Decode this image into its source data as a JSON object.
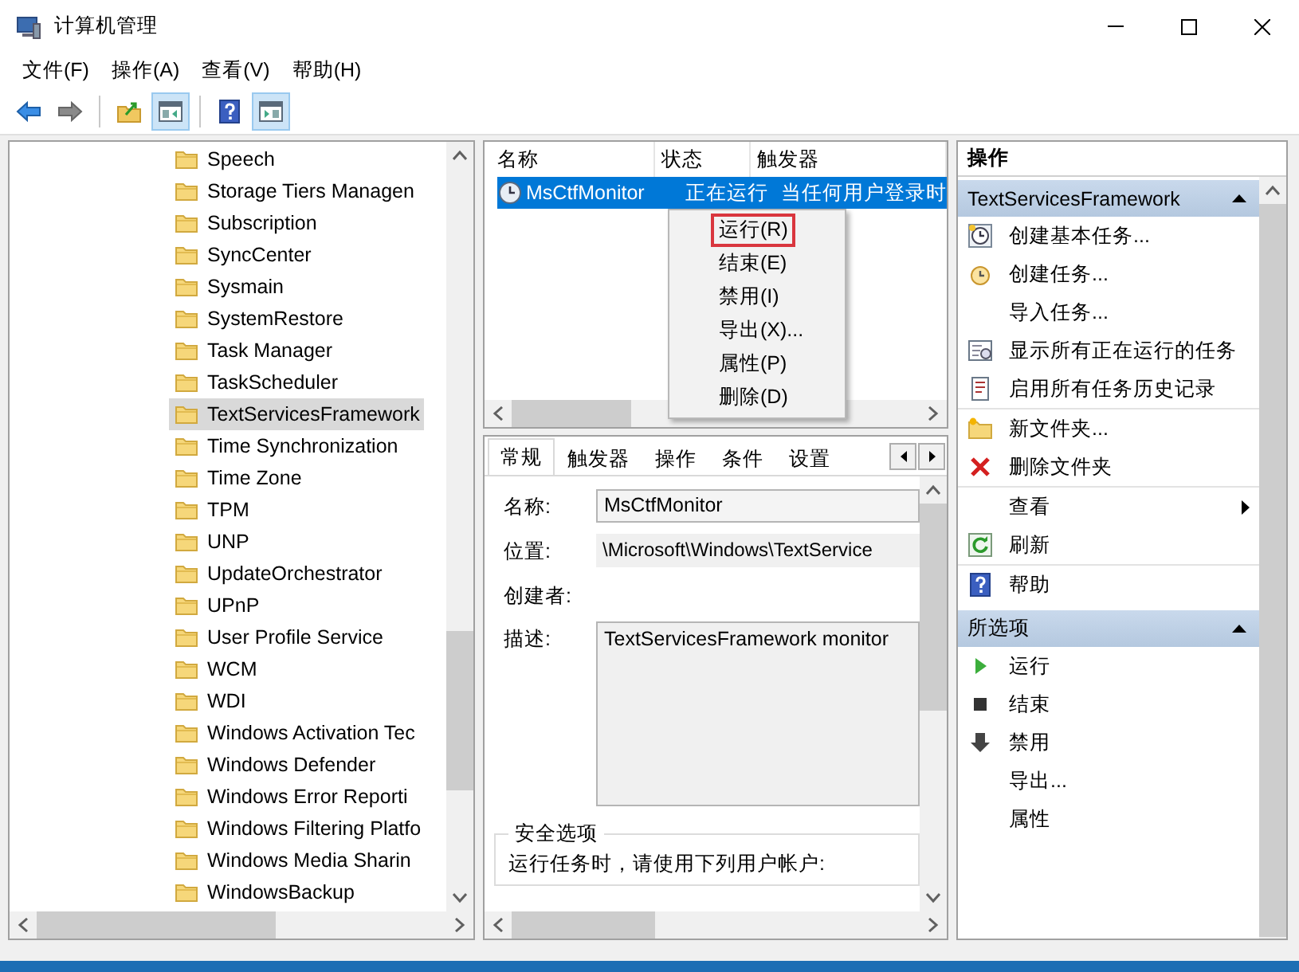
{
  "window": {
    "title": "计算机管理"
  },
  "menu_bar": [
    "文件(F)",
    "操作(A)",
    "查看(V)",
    "帮助(H)"
  ],
  "toolbar": {
    "groups": [
      [
        {
          "kind": "back",
          "pressed": false
        },
        {
          "kind": "forward",
          "pressed": false
        }
      ],
      [
        {
          "kind": "up",
          "pressed": false
        },
        {
          "kind": "console_tree",
          "pressed": true
        }
      ],
      [
        {
          "kind": "help",
          "pressed": false
        },
        {
          "kind": "action_pane",
          "pressed": true
        }
      ]
    ]
  },
  "tree": {
    "items": [
      {
        "label": "Speech",
        "selected": false
      },
      {
        "label": "Storage Tiers Managen",
        "selected": false
      },
      {
        "label": "Subscription",
        "selected": false
      },
      {
        "label": "SyncCenter",
        "selected": false
      },
      {
        "label": "Sysmain",
        "selected": false
      },
      {
        "label": "SystemRestore",
        "selected": false
      },
      {
        "label": "Task Manager",
        "selected": false
      },
      {
        "label": "TaskScheduler",
        "selected": false
      },
      {
        "label": "TextServicesFramework",
        "selected": true
      },
      {
        "label": "Time Synchronization",
        "selected": false
      },
      {
        "label": "Time Zone",
        "selected": false
      },
      {
        "label": "TPM",
        "selected": false
      },
      {
        "label": "UNP",
        "selected": false
      },
      {
        "label": "UpdateOrchestrator",
        "selected": false
      },
      {
        "label": "UPnP",
        "selected": false
      },
      {
        "label": "User Profile Service",
        "selected": false
      },
      {
        "label": "WCM",
        "selected": false
      },
      {
        "label": "WDI",
        "selected": false
      },
      {
        "label": "Windows Activation Tec",
        "selected": false
      },
      {
        "label": "Windows Defender",
        "selected": false
      },
      {
        "label": "Windows Error Reporti",
        "selected": false
      },
      {
        "label": "Windows Filtering Platfo",
        "selected": false
      },
      {
        "label": "Windows Media Sharin",
        "selected": false
      },
      {
        "label": "WindowsBackup",
        "selected": false
      }
    ]
  },
  "task_list": {
    "columns": [
      "名称",
      "状态",
      "触发器"
    ],
    "rows": [
      {
        "name": "MsCtfMonitor",
        "status": "正在运行",
        "trigger": "当任何用户登录时",
        "selected": true
      }
    ]
  },
  "context_menu": {
    "items": [
      {
        "label": "运行(R)",
        "outlined": true
      },
      {
        "label": "结束(E)",
        "outlined": false
      },
      {
        "label": "禁用(I)",
        "outlined": false
      },
      {
        "label": "导出(X)...",
        "outlined": false
      },
      {
        "label": "属性(P)",
        "outlined": false
      },
      {
        "label": "删除(D)",
        "outlined": false
      }
    ]
  },
  "details": {
    "tabs": [
      {
        "label": "常规",
        "selected": true
      },
      {
        "label": "触发器",
        "selected": false
      },
      {
        "label": "操作",
        "selected": false
      },
      {
        "label": "条件",
        "selected": false
      },
      {
        "label": "设置",
        "selected": false
      }
    ],
    "fields": [
      {
        "label": "名称:",
        "kind": "input",
        "value": "MsCtfMonitor"
      },
      {
        "label": "位置:",
        "kind": "text",
        "value": "\\Microsoft\\Windows\\TextService"
      },
      {
        "label": "创建者:",
        "kind": "text"
      },
      {
        "label": "描述:",
        "kind": "textarea",
        "value": "TextServicesFramework monitor"
      }
    ],
    "security": {
      "title": "安全选项",
      "text": "运行任务时，请使用下列用户帐户:"
    }
  },
  "actions": {
    "title": "操作",
    "sections": [
      {
        "title": "TextServicesFramework",
        "expanded": true,
        "groups": [
          [
            {
              "label": "创建基本任务...",
              "kind": "basic_task"
            },
            {
              "label": "创建任务...",
              "kind": "create_task"
            },
            {
              "label": "导入任务...",
              "kind": "none"
            },
            {
              "label": "显示所有正在运行的任务",
              "kind": "running"
            },
            {
              "label": "启用所有任务历史记录",
              "kind": "history"
            }
          ],
          [
            {
              "label": "新文件夹...",
              "kind": "new_folder"
            },
            {
              "label": "删除文件夹",
              "kind": "delete"
            }
          ],
          [
            {
              "label": "查看",
              "kind": "submenu"
            },
            {
              "label": "刷新",
              "kind": "refresh"
            }
          ],
          [
            {
              "label": "帮助",
              "kind": "help"
            }
          ]
        ]
      },
      {
        "title": "所选项",
        "expanded": true,
        "groups": [
          [
            {
              "label": "运行",
              "kind": "run"
            },
            {
              "label": "结束",
              "kind": "end"
            },
            {
              "label": "禁用",
              "kind": "disable"
            },
            {
              "label": "导出...",
              "kind": "none"
            },
            {
              "label": "属性",
              "kind": "none"
            }
          ]
        ]
      }
    ]
  }
}
